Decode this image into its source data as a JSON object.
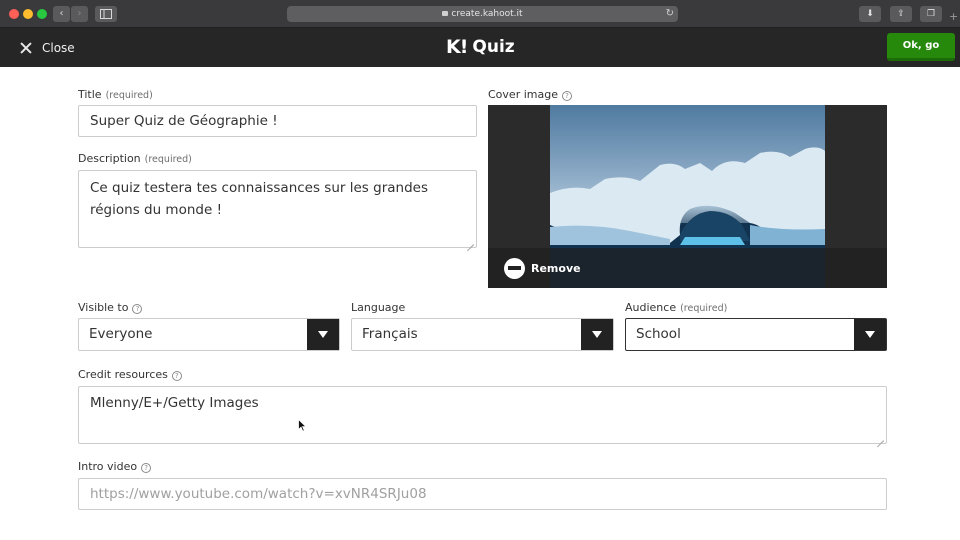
{
  "browser": {
    "url": "create.kahoot.it"
  },
  "header": {
    "close_label": "Close",
    "logo_mark": "K!",
    "logo_text": "Quiz",
    "ok_label": "Ok, go"
  },
  "form": {
    "title": {
      "label": "Title",
      "required": "(required)",
      "value": "Super Quiz de Géographie !"
    },
    "description": {
      "label": "Description",
      "required": "(required)",
      "value_line1": "Ce quiz testera tes connaissances sur les grandes",
      "value_line2": "régions du monde !"
    },
    "cover": {
      "label": "Cover image",
      "remove_label": "Remove"
    },
    "visible_to": {
      "label": "Visible to",
      "value": "Everyone"
    },
    "language": {
      "label": "Language",
      "value": "Français"
    },
    "audience": {
      "label": "Audience",
      "required": "(required)",
      "value": "School"
    },
    "credit": {
      "label": "Credit resources",
      "value": "Mlenny/E+/Getty Images"
    },
    "intro_video": {
      "label": "Intro video",
      "placeholder": "https://www.youtube.com/watch?v=xvNR4SRJu08"
    }
  },
  "colors": {
    "header_bg": "#262626",
    "ok_button": "#26890c",
    "select_arrow_bg": "#222222"
  }
}
